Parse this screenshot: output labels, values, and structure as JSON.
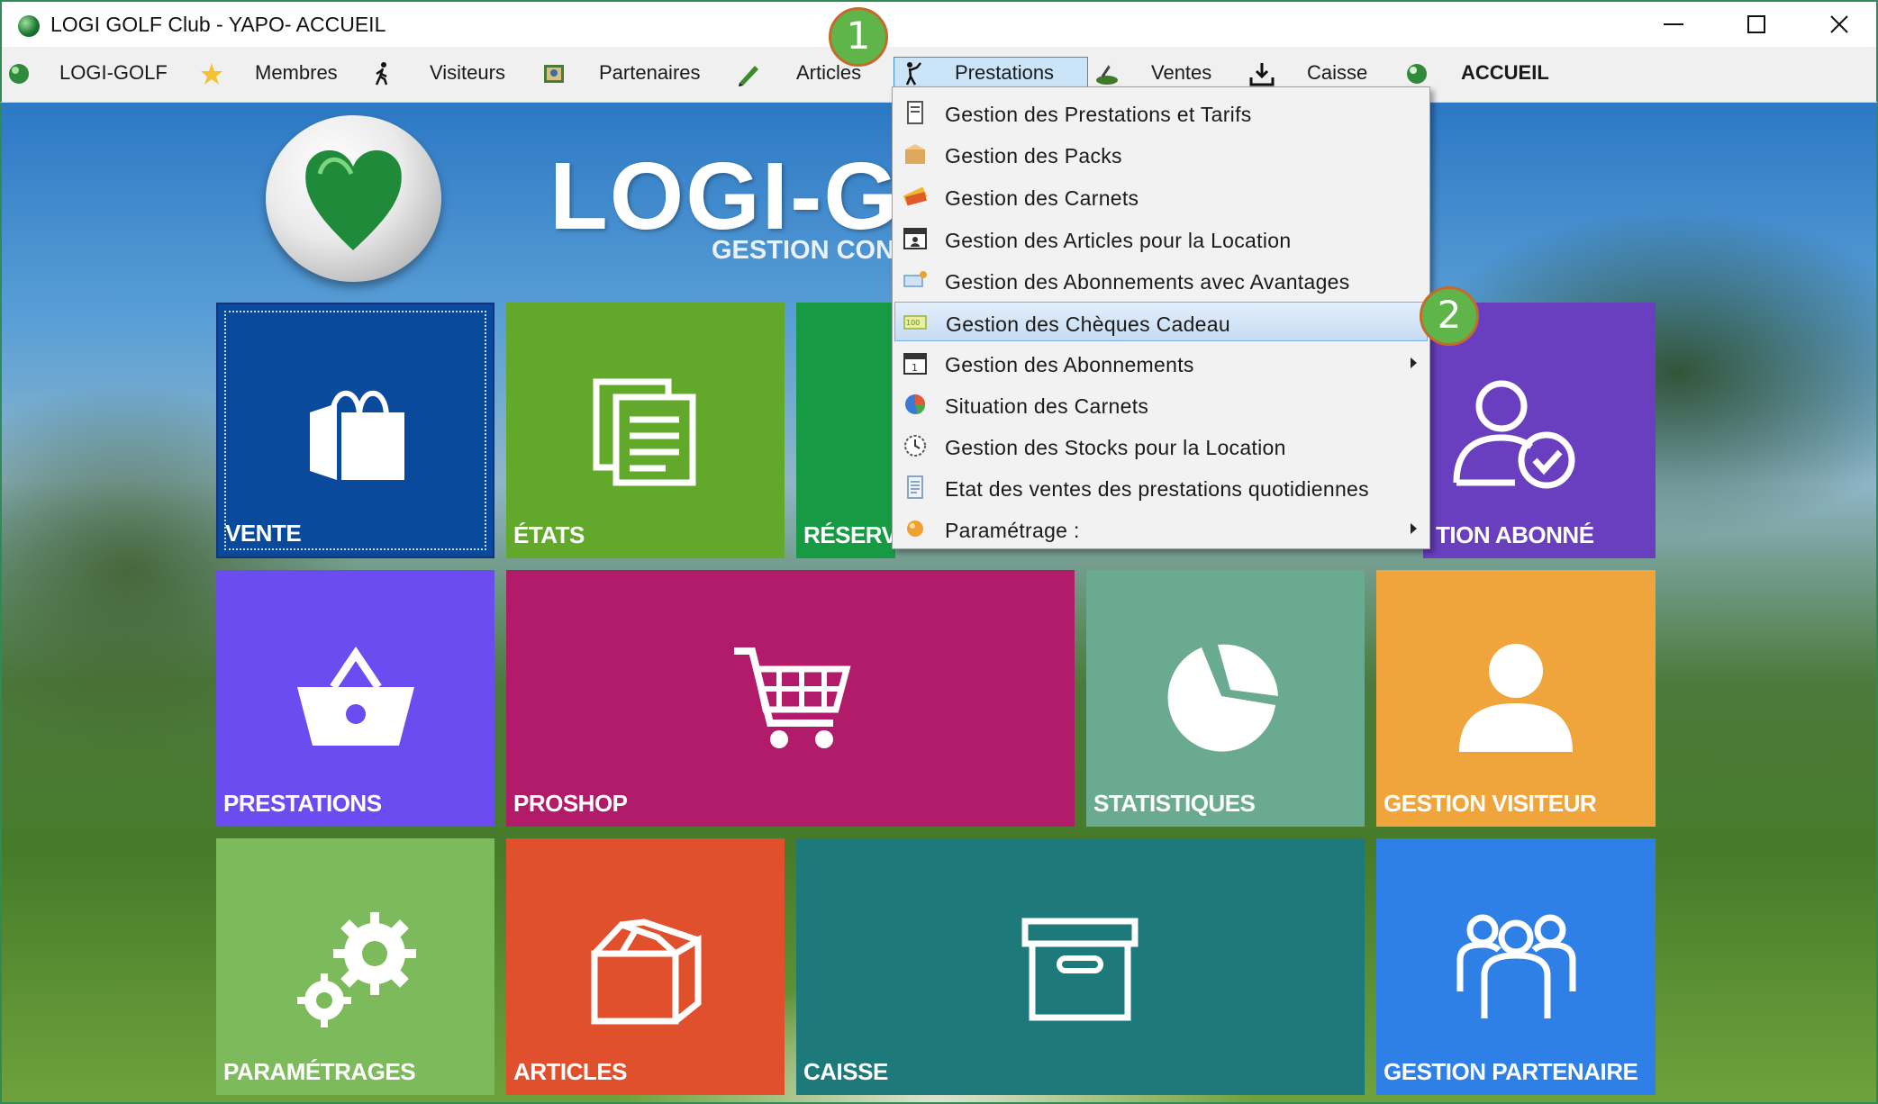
{
  "window": {
    "title": "LOGI GOLF Club - YAPO- ACCUEIL",
    "minimize_icon": "minimize-icon",
    "maximize_icon": "maximize-icon",
    "close_icon": "close-icon"
  },
  "menubar": {
    "items": [
      {
        "label": "LOGI-GOLF",
        "icon": "golf-ball-icon"
      },
      {
        "label": "Membres",
        "icon": "star-icon"
      },
      {
        "label": "Visiteurs",
        "icon": "walking-person-icon"
      },
      {
        "label": "Partenaires",
        "icon": "partners-icon"
      },
      {
        "label": "Articles",
        "icon": "pen-icon"
      },
      {
        "label": "Prestations",
        "icon": "golfer-icon"
      },
      {
        "label": "Ventes",
        "icon": "ventes-icon"
      },
      {
        "label": "Caisse",
        "icon": "download-icon"
      },
      {
        "label": "ACCUEIL",
        "icon": "home-ball-icon"
      }
    ],
    "active": "Prestations"
  },
  "logo": {
    "text": "LOGI-GC",
    "subtitle": "GESTION CON"
  },
  "dropdown": {
    "items": [
      {
        "label": "Gestion des Prestations et Tarifs",
        "icon": "document-icon",
        "submenu": false
      },
      {
        "label": "Gestion des Packs",
        "icon": "box-icon",
        "submenu": false
      },
      {
        "label": "Gestion des Carnets",
        "icon": "tickets-icon",
        "submenu": false
      },
      {
        "label": "Gestion des Articles pour la Location",
        "icon": "calendar-person-icon",
        "submenu": false
      },
      {
        "label": "Gestion des Abonnements avec Avantages",
        "icon": "card-icon",
        "submenu": false
      },
      {
        "label": "Gestion des Chèques Cadeau",
        "icon": "cheque-icon",
        "submenu": false,
        "highlighted": true
      },
      {
        "label": "Gestion des Abonnements",
        "icon": "calendar-icon",
        "submenu": true
      },
      {
        "label": "Situation des Carnets",
        "icon": "pie-chart-icon",
        "submenu": false
      },
      {
        "label": "Gestion des Stocks pour la Location",
        "icon": "clock-icon",
        "submenu": false
      },
      {
        "label": "Etat des ventes des prestations quotidiennes",
        "icon": "report-icon",
        "submenu": false
      },
      {
        "label": "Paramétrage :",
        "icon": "settings-orb-icon",
        "submenu": true
      }
    ]
  },
  "tiles": {
    "vente": {
      "label": "VENTE",
      "color": "#0a4a9c",
      "icon": "shopping-bag-icon"
    },
    "etats": {
      "label": "ÉTATS",
      "color": "#62a82a",
      "icon": "documents-icon"
    },
    "reservation": {
      "label": "RÉSERVA",
      "color": "#179a44",
      "icon": ""
    },
    "abonne": {
      "label": "TION ABONNÉ",
      "color": "#6a3fbf",
      "icon": "user-check-icon"
    },
    "prestations": {
      "label": "PRESTATIONS",
      "color": "#6a4cf0",
      "icon": "basket-icon"
    },
    "proshop": {
      "label": "PROSHOP",
      "color": "#b21a6a",
      "icon": "cart-icon"
    },
    "statistiques": {
      "label": "STATISTIQUES",
      "color": "#6aaa90",
      "icon": "pie-chart-icon"
    },
    "visiteur": {
      "label": "GESTION VISITEUR",
      "color": "#f0a53c",
      "icon": "user-icon"
    },
    "parametrages": {
      "label": "PARAMÉTRAGES",
      "color": "#7dba5c",
      "icon": "gears-icon"
    },
    "articles": {
      "label": "ARTICLES",
      "color": "#e0502c",
      "icon": "open-box-icon"
    },
    "caisse": {
      "label": "CAISSE",
      "color": "#1e7a7a",
      "icon": "archive-box-icon"
    },
    "partenaire": {
      "label": "GESTION PARTENAIRE",
      "color": "#2f80e6",
      "icon": "group-icon"
    }
  },
  "callouts": {
    "one": "1",
    "two": "2"
  }
}
